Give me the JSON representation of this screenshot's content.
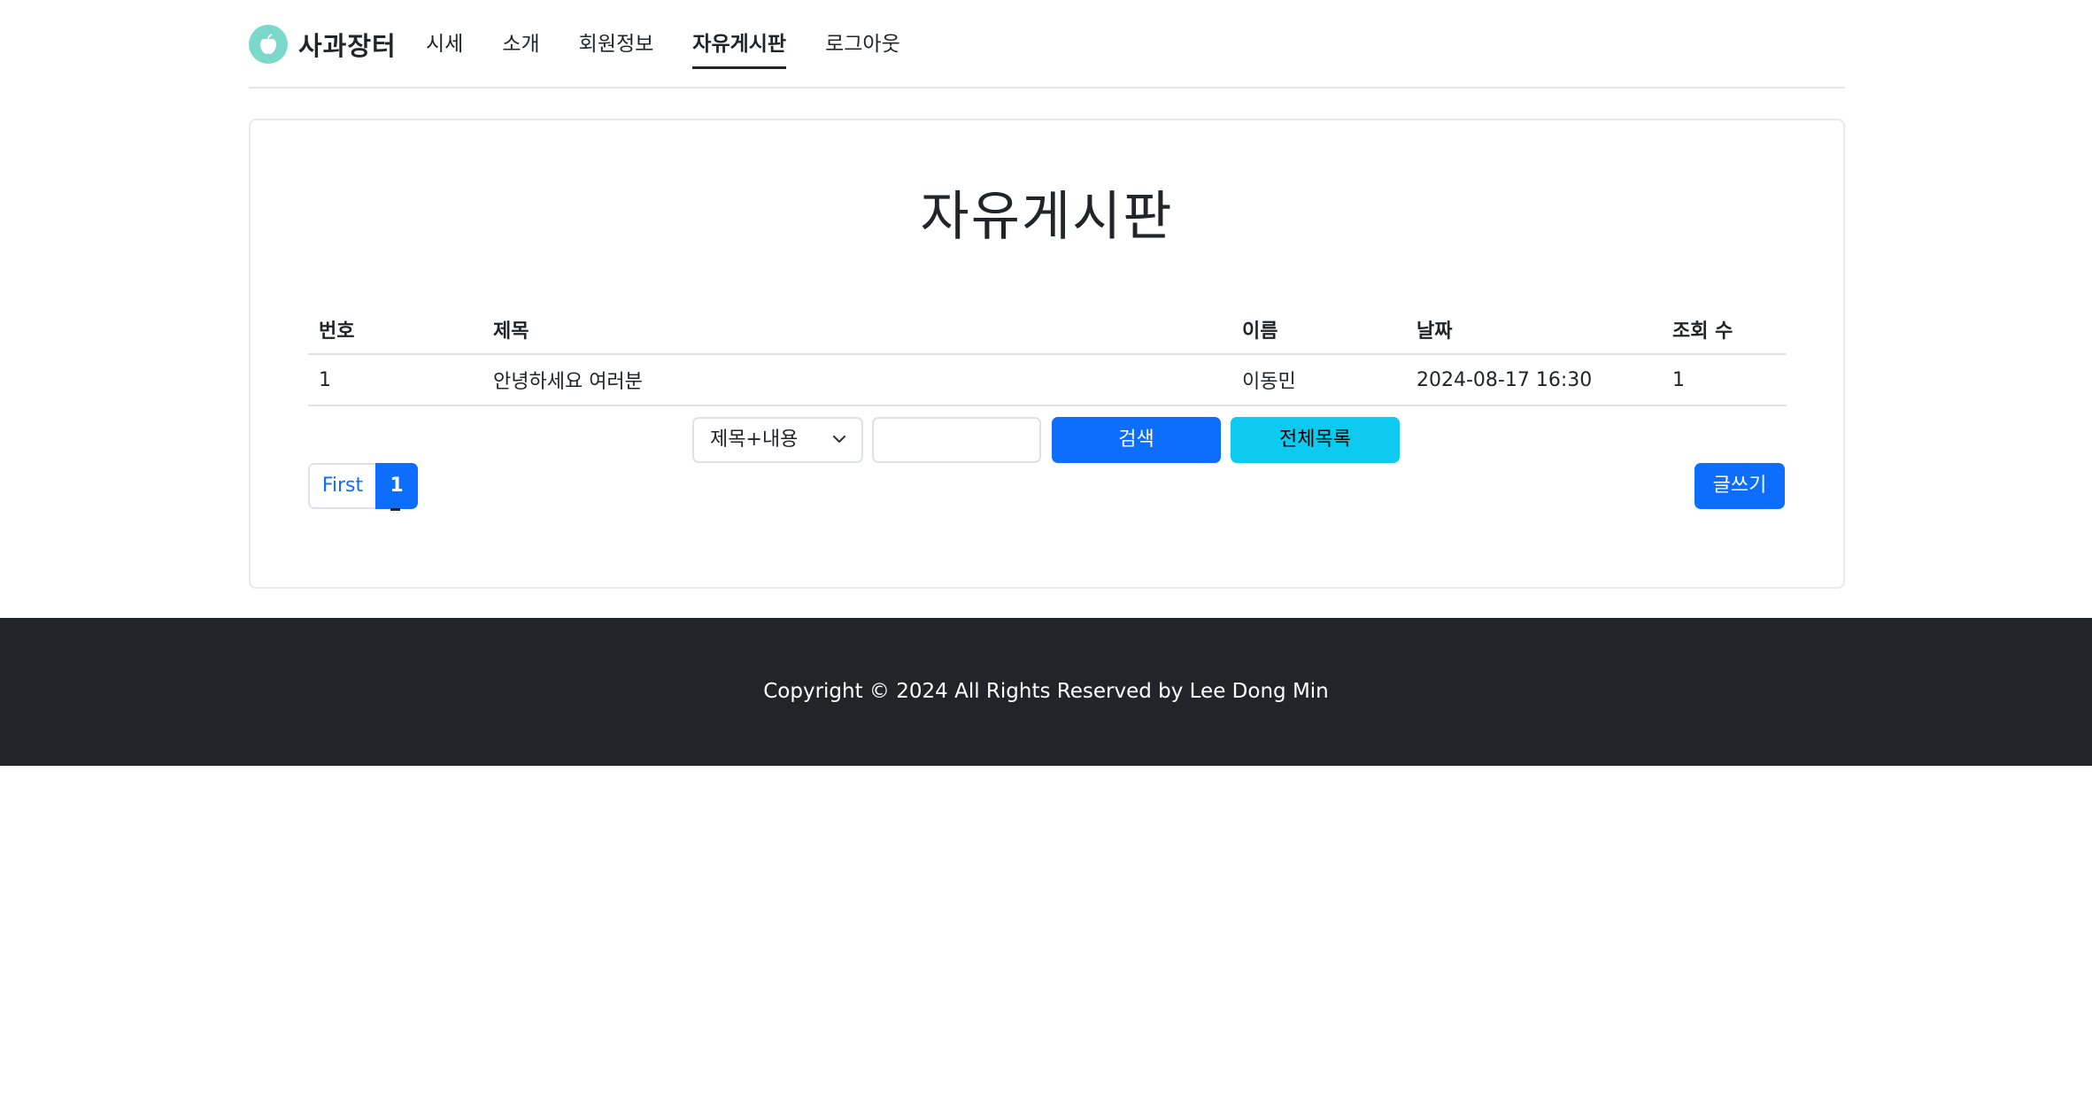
{
  "header": {
    "brand_name": "사과장터",
    "nav": [
      "시세",
      "소개",
      "회원정보",
      "자유게시판",
      "로그아웃"
    ],
    "active_nav": "자유게시판"
  },
  "board": {
    "title": "자유게시판",
    "columns": [
      "번호",
      "제목",
      "이름",
      "날짜",
      "조회 수"
    ],
    "rows": [
      {
        "no": "1",
        "title": "안녕하세요 여러분",
        "name": "이동민",
        "date": "2024-08-17 16:30",
        "views": "1"
      }
    ]
  },
  "search": {
    "selected_option": "제목+내용",
    "input_value": "",
    "search_label": "검색",
    "all_list_label": "전체목록"
  },
  "pagination": {
    "first_label": "First",
    "current_page": "1"
  },
  "write_label": "글쓰기",
  "footer": {
    "copyright": "Copyright © 2024 All Rights Reserved by Lee Dong Min"
  },
  "colors": {
    "primary": "#0d6efd",
    "info": "#0dcaf0",
    "footer_bg": "#212529",
    "logo": "#7dd8cc"
  },
  "icons": {
    "brand": "apple-icon",
    "select": "chevron-down-icon"
  }
}
